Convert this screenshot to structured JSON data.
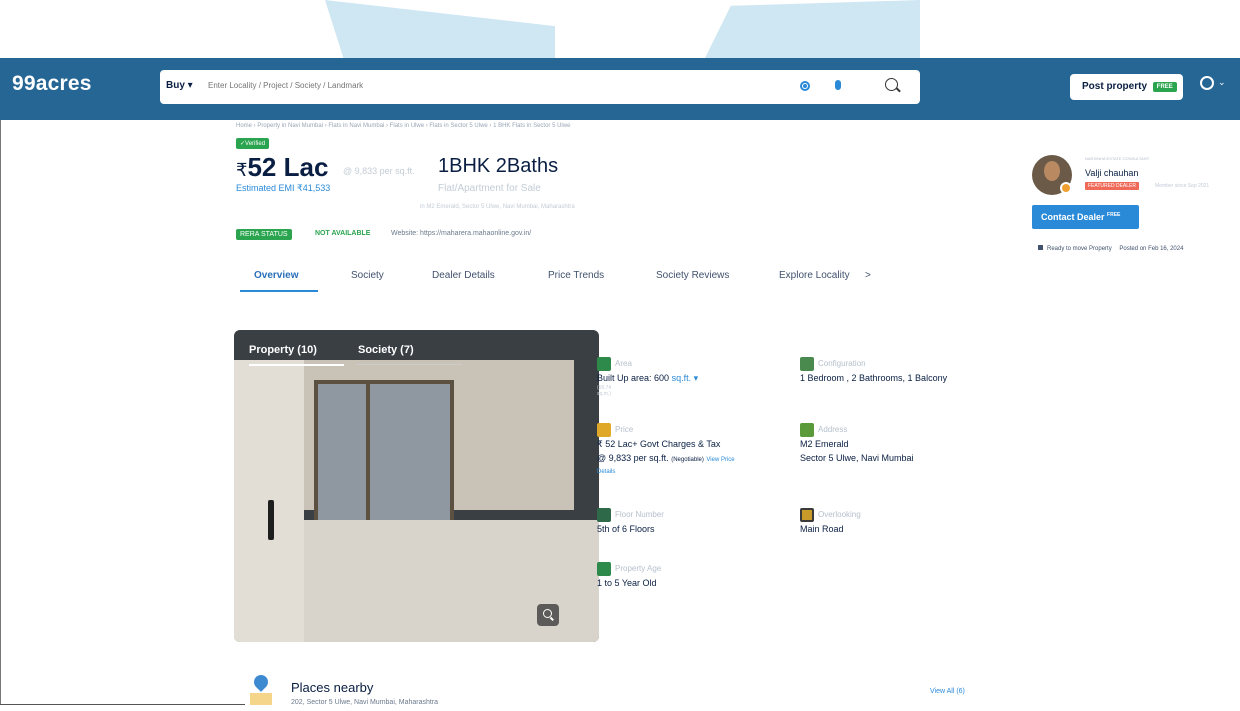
{
  "header": {
    "logo": "99acres",
    "buy_label": "Buy ▾",
    "search_placeholder": "Enter Locality / Project / Society / Landmark",
    "post_label": "Post property",
    "free_badge": "FREE"
  },
  "listing": {
    "breadcrumb": "Home › Property in Navi Mumbai › Flats in Navi Mumbai › Flats in Ulwe › Flats in Sector 5 Ulwe › 1 BHK Flats in Sector 5 Ulwe",
    "verified": "✓Verified",
    "currency": "₹",
    "price": "52 Lac",
    "per_sqft": "@ 9,833 per sq.ft.",
    "emi": "Estimated EMI ₹41,533",
    "config": "1BHK 2Baths",
    "type": "Flat/Apartment for Sale",
    "address_line": "in M2 Emerald, Sector 5 Ulwe, Navi Mumbai, Maharashtra",
    "rera_label": "RERA STATUS",
    "rera_status": "NOT AVAILABLE",
    "website": "Website: https://maharera.mahaonline.gov.in/"
  },
  "tabs": [
    {
      "label": "Overview"
    },
    {
      "label": "Society"
    },
    {
      "label": "Dealer Details"
    },
    {
      "label": "Price Trends"
    },
    {
      "label": "Society Reviews"
    },
    {
      "label": "Explore Locality"
    },
    {
      "label": ">"
    }
  ],
  "gallery": {
    "property_tab": "Property (10)",
    "society_tab": "Society (7)"
  },
  "details": {
    "area_label": "Area",
    "area_value": "Built Up area: 600",
    "area_unit": "sq.ft. ▾",
    "area_sub": "(55.74 sq.m.)",
    "config_label": "Configuration",
    "config_value": "1 Bedroom , 2 Bathrooms, 1 Balcony",
    "price_label": "Price",
    "price_value": "₹ 52 Lac+ Govt Charges & Tax",
    "price_rate": "@ 9,833 per sq.ft.",
    "negotiable": "(Negotiable)",
    "price_link": "View Price",
    "price_link2": "Details",
    "address_label": "Address",
    "address_1": "M2 Emerald",
    "address_2": "Sector 5 Ulwe, Navi Mumbai",
    "floor_label": "Floor Number",
    "floor_value": "5th of 6 Floors",
    "overlooking_label": "Overlooking",
    "overlooking_value": "Main Road",
    "age_label": "Property Age",
    "age_value": "1 to 5 Year Old"
  },
  "dealer": {
    "role": "NARSINHA ESTATE CONSULTANT",
    "name": "Valji chauhan",
    "featured": "FEATURED DEALER",
    "since": "Member since Sep 2021",
    "contact_label": "Contact Dealer",
    "contact_free": "FREE",
    "ready": "Ready to move Property",
    "posted": "Posted on Feb 16, 2024"
  },
  "places": {
    "title": "Places nearby",
    "subtitle": "202, Sector 5 Ulwe, Navi Mumbai, Maharashtra",
    "view_all": "View All (6)"
  },
  "colors": {
    "header_bg": "#256695",
    "accent": "#2a8ad8",
    "green": "#2aa44f"
  }
}
